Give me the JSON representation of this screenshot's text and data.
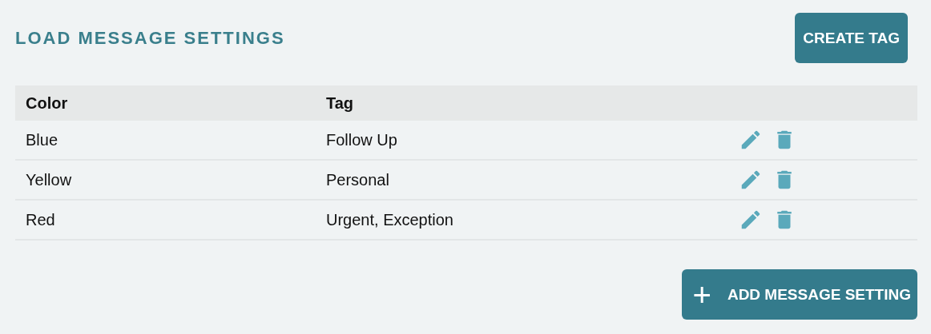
{
  "title": "LOAD MESSAGE SETTINGS",
  "create_button": "CREATE TAG",
  "table": {
    "columns": [
      "Color",
      "Tag"
    ],
    "rows": [
      {
        "color_name": "Blue",
        "tag": "Follow Up"
      },
      {
        "color_name": "Yellow",
        "tag": "Personal"
      },
      {
        "color_name": "Red",
        "tag": "Urgent, Exception"
      }
    ]
  },
  "add_button": {
    "icon": "+",
    "label": "ADD MESSAGE SETTING"
  }
}
